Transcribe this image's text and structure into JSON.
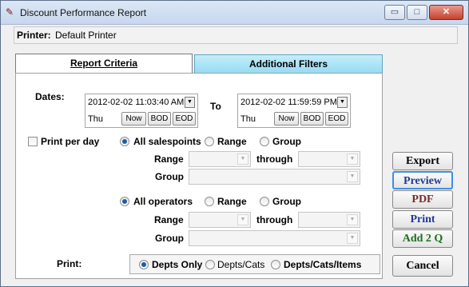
{
  "window": {
    "title": "Discount Performance Report",
    "icon": "feather-icon",
    "buttons": {
      "minimize": "▭",
      "maximize": "□",
      "close": "✕"
    }
  },
  "printer": {
    "label": "Printer:",
    "value": "Default Printer"
  },
  "tabs": {
    "report_criteria": "Report Criteria",
    "additional_filters": "Additional Filters"
  },
  "dates": {
    "label": "Dates:",
    "to_label": "To",
    "from": {
      "value": "2012-02-02 11:03:40 AM",
      "day": "Thu"
    },
    "to": {
      "value": "2012-02-02 11:59:59 PM",
      "day": "Thu"
    },
    "buttons": {
      "now": "Now",
      "bod": "BOD",
      "eod": "EOD"
    }
  },
  "print_per_day": {
    "label": "Print per day",
    "checked": false
  },
  "salespoints": {
    "options": {
      "all": "All salespoints",
      "range": "Range",
      "group": "Group"
    },
    "selected": "all",
    "range_label": "Range",
    "through_label": "through",
    "group_label": "Group"
  },
  "operators": {
    "options": {
      "all": "All operators",
      "range": "Range",
      "group": "Group"
    },
    "selected": "all",
    "range_label": "Range",
    "through_label": "through",
    "group_label": "Group"
  },
  "print": {
    "label": "Print:",
    "options": {
      "depts_only": "Depts Only",
      "depts_cats": "Depts/Cats",
      "depts_cats_items": "Depts/Cats/Items"
    },
    "selected": "depts_only"
  },
  "actions": {
    "export": "Export",
    "preview": "Preview",
    "pdf": "PDF",
    "print": "Print",
    "add2q": "Add 2 Q",
    "cancel": "Cancel"
  },
  "colors": {
    "preview": "#1f3a9a",
    "pdf": "#7a2a2a",
    "print": "#1f3a9a",
    "add2q": "#1e6e1e",
    "tab_inactive": "#a9e2f6"
  }
}
